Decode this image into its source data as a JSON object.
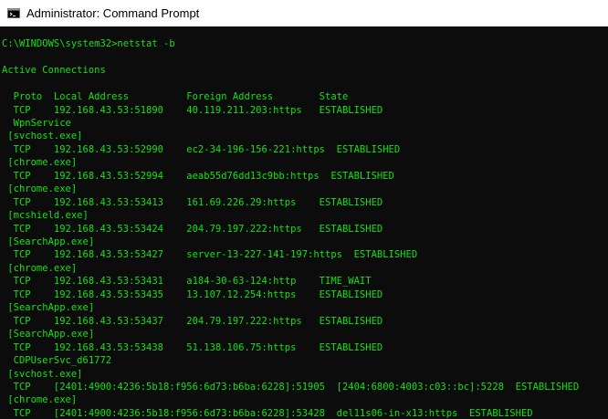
{
  "window": {
    "title": "Administrator: Command Prompt",
    "icon": "cmd-icon"
  },
  "colors": {
    "console_background": "#0c0c0c",
    "console_text": "#13e113",
    "titlebar_background": "#ffffff"
  },
  "console": {
    "command_line": "C:\\WINDOWS\\system32>netstat -b",
    "section_heading": "Active Connections",
    "header": "  Proto  Local Address          Foreign Address        State",
    "lines": [
      "  TCP    192.168.43.53:51890    40.119.211.203:https   ESTABLISHED",
      "  WpnService",
      " [svchost.exe]",
      "  TCP    192.168.43.53:52990    ec2-34-196-156-221:https  ESTABLISHED",
      " [chrome.exe]",
      "  TCP    192.168.43.53:52994    aeab55d76dd13c9bb:https  ESTABLISHED",
      " [chrome.exe]",
      "  TCP    192.168.43.53:53413    161.69.226.29:https    ESTABLISHED",
      " [mcshield.exe]",
      "  TCP    192.168.43.53:53424    204.79.197.222:https   ESTABLISHED",
      " [SearchApp.exe]",
      "  TCP    192.168.43.53:53427    server-13-227-141-197:https  ESTABLISHED",
      " [chrome.exe]",
      "  TCP    192.168.43.53:53431    a184-30-63-124:http    TIME_WAIT",
      "  TCP    192.168.43.53:53435    13.107.12.254:https    ESTABLISHED",
      " [SearchApp.exe]",
      "  TCP    192.168.43.53:53437    204.79.197.222:https   ESTABLISHED",
      " [SearchApp.exe]",
      "  TCP    192.168.43.53:53438    51.138.106.75:https    ESTABLISHED",
      "  CDPUserSvc_d61772",
      " [svchost.exe]",
      "  TCP    [2401:4900:4236:5b18:f956:6d73:b6ba:6228]:51905  [2404:6800:4003:c03::bc]:5228  ESTABLISHED",
      " [chrome.exe]",
      "  TCP    [2401:4900:4236:5b18:f956:6d73:b6ba:6228]:53428  del11s06-in-x13:https  ESTABLISHED"
    ]
  }
}
